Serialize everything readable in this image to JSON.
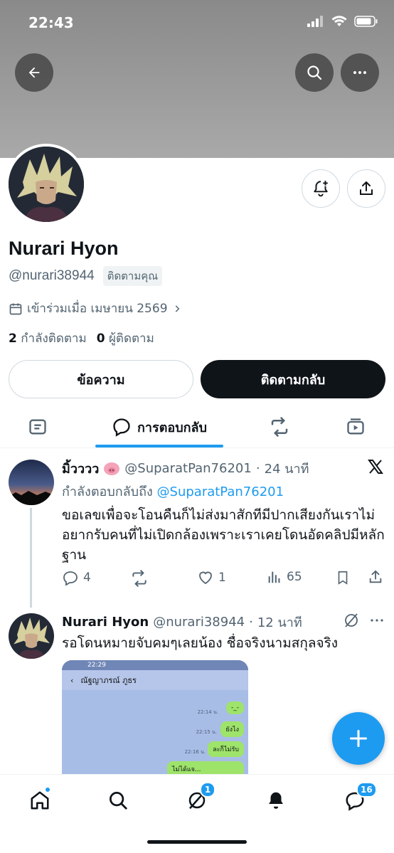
{
  "status_bar": {
    "time": "22:43"
  },
  "profile": {
    "display_name": "Nurari Hyon",
    "handle": "@nurari38944",
    "follows_you": "ติดตามคุณ",
    "joined": "เข้าร่วมเมื่อ เมษายน 2569",
    "following_count": "2",
    "following_label": "กำลังติดตาม",
    "followers_count": "0",
    "followers_label": "ผู้ติดตาม",
    "message_button": "ข้อความ",
    "follow_back_button": "ติดตามกลับ"
  },
  "tabs": {
    "active_label": "การตอบกลับ"
  },
  "tweet1": {
    "name": "มิ้วววว",
    "handle": "@SuparatPan76201",
    "time": "24 นาที",
    "reply_prefix": "กำลังตอบกลับถึง",
    "reply_handle": "@SuparatPan76201",
    "text": "ขอเลขเพื่อจะโอนคืนก็ไม่ส่งมาสักทีมีปากเสียงกันเราไม่อยากรับคนที่ไม่เปิดกล้องเพราะเราเคยโดนอัดคลิปมีหลักฐาน",
    "replies": "4",
    "likes": "1",
    "views": "65"
  },
  "tweet2": {
    "name": "Nurari Hyon",
    "handle": "@nurari38944",
    "time": "12 นาที",
    "text": "รอโดนหมายจับคมๆเลยน้อง ชื่อจริงนามสกุลจริง",
    "media": {
      "status_time": "22:29",
      "contact_name": "ณัฐญาภรณ์ ภูธร",
      "messages": [
        {
          "time": "22:14 น.",
          "text": "-_-"
        },
        {
          "time": "22:15 น.",
          "text": "ยังไง"
        },
        {
          "time": "22:16 น.",
          "text": "ละก็ไม่รับ"
        },
        {
          "time": "",
          "text": "ไม่ได้แจ..."
        }
      ]
    }
  },
  "bottom_nav": {
    "grok_badge": "1",
    "messages_badge": "16"
  },
  "colors": {
    "accent": "#1d9bf0",
    "text": "#0f1419",
    "muted": "#536471"
  }
}
